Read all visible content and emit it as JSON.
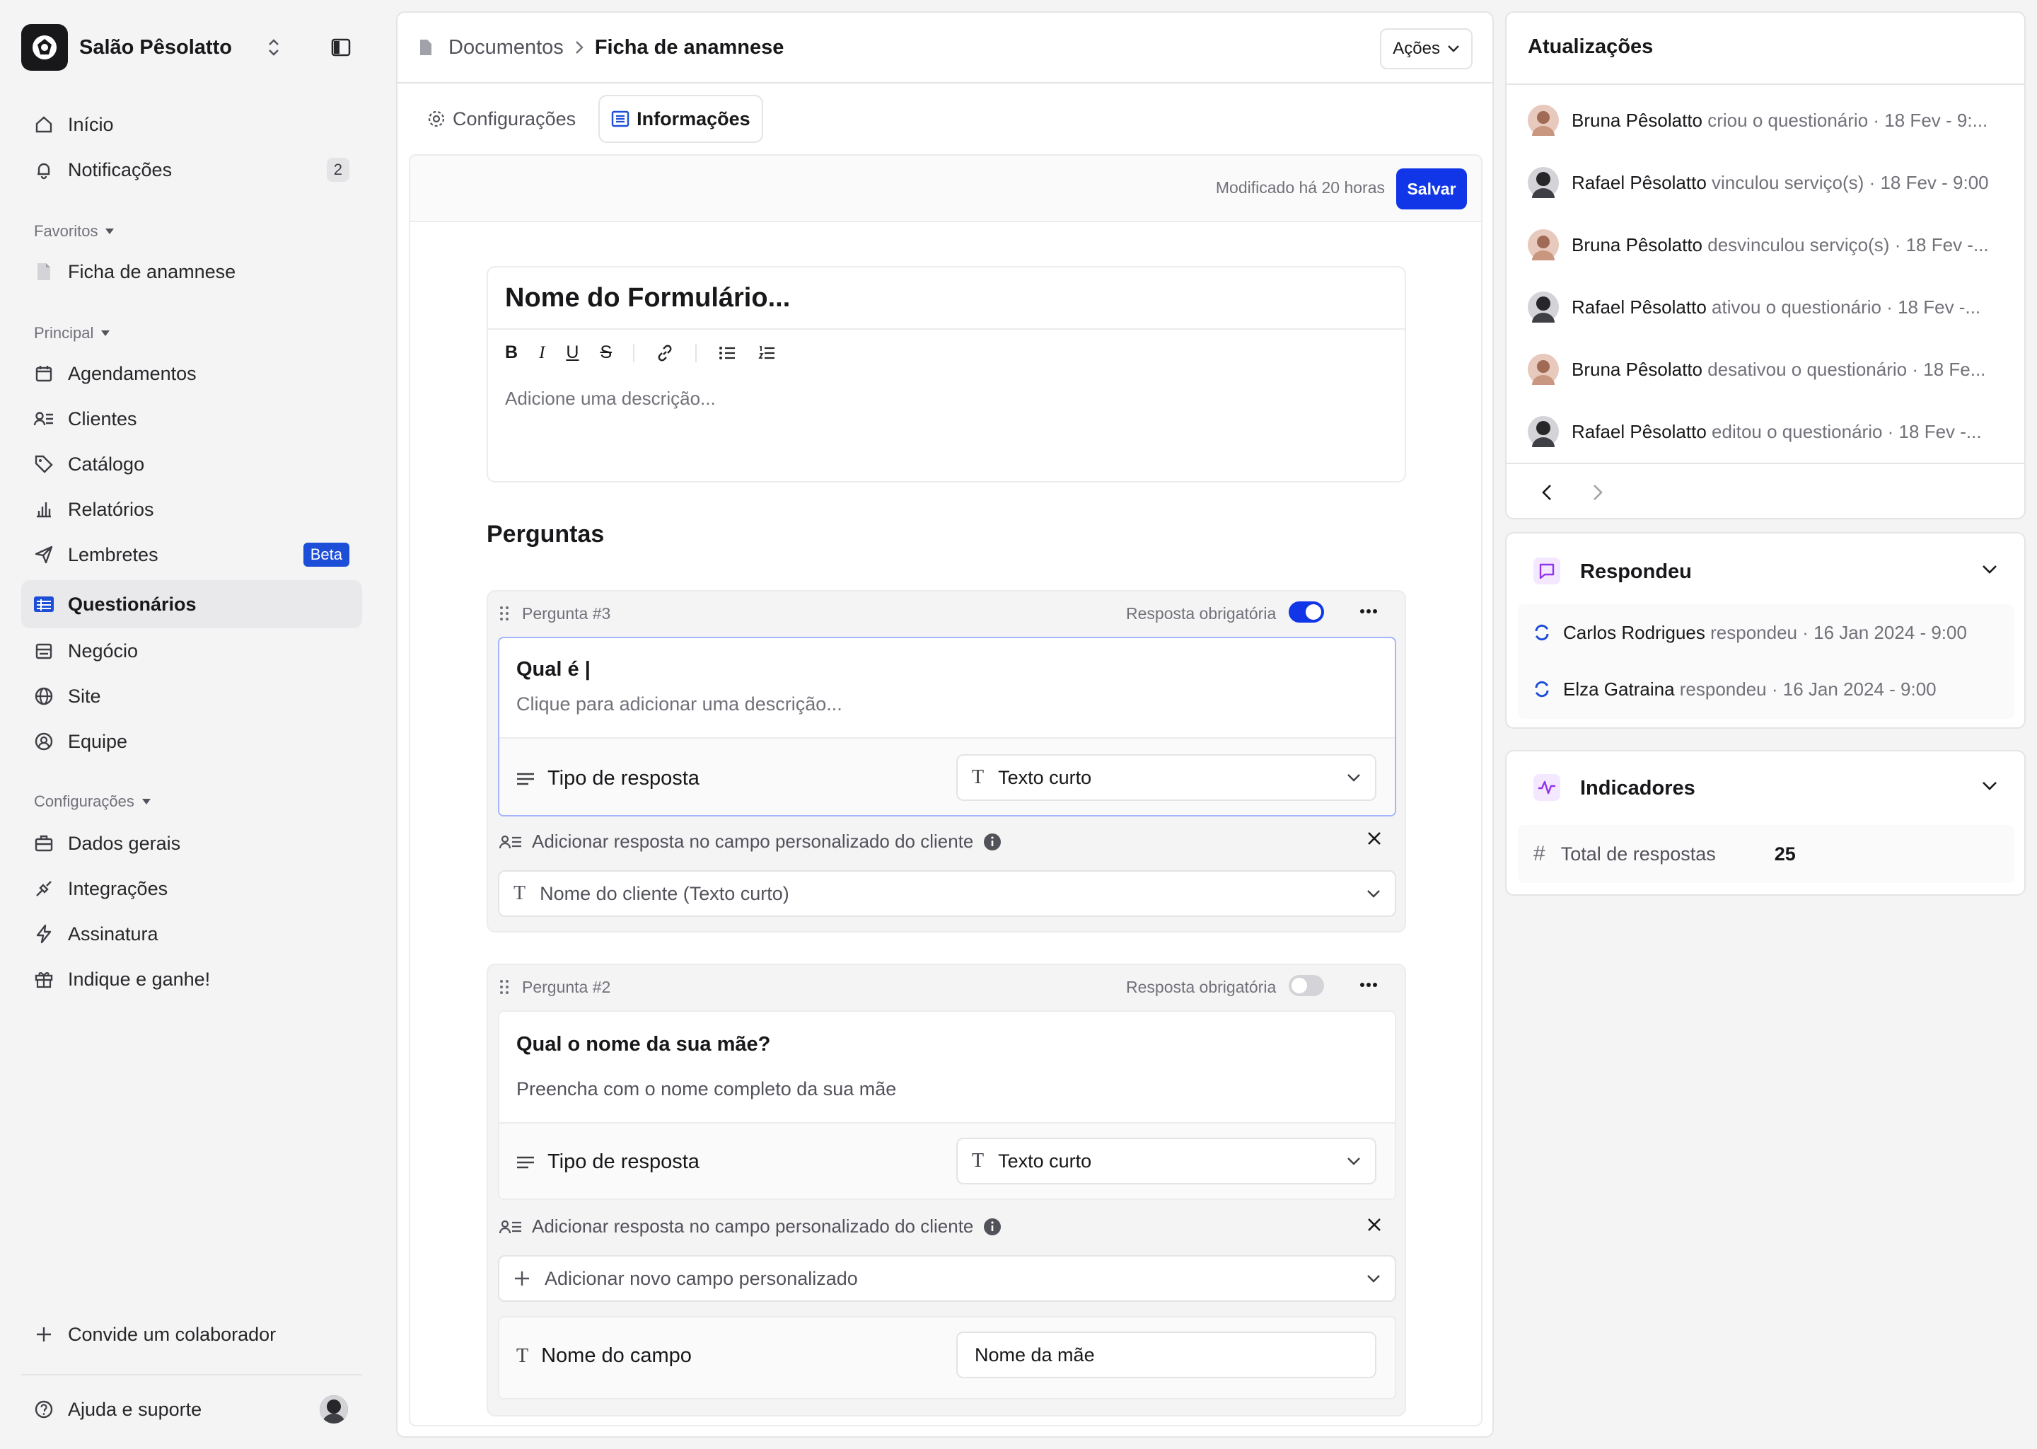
{
  "workspace": {
    "name": "Salão Pêsolatto"
  },
  "nav_top": [
    {
      "label": "Início",
      "icon": "home-icon"
    },
    {
      "label": "Notificações",
      "icon": "bell-icon",
      "count": "2"
    }
  ],
  "favorites": {
    "title": "Favoritos",
    "items": [
      {
        "label": "Ficha de anamnese",
        "icon": "document-icon"
      }
    ]
  },
  "principal": {
    "title": "Principal",
    "items": [
      {
        "label": "Agendamentos",
        "icon": "calendar-icon"
      },
      {
        "label": "Clientes",
        "icon": "clients-icon"
      },
      {
        "label": "Catálogo",
        "icon": "tag-icon"
      },
      {
        "label": "Relatórios",
        "icon": "chart-icon"
      },
      {
        "label": "Lembretes",
        "icon": "send-icon",
        "badge": "Beta"
      },
      {
        "label": "Questionários",
        "icon": "form-icon",
        "active": true
      },
      {
        "label": "Negócio",
        "icon": "store-icon"
      },
      {
        "label": "Site",
        "icon": "globe-icon"
      },
      {
        "label": "Equipe",
        "icon": "team-icon"
      }
    ]
  },
  "config": {
    "title": "Configurações",
    "items": [
      {
        "label": "Dados gerais",
        "icon": "briefcase-icon"
      },
      {
        "label": "Integrações",
        "icon": "plug-icon"
      },
      {
        "label": "Assinatura",
        "icon": "bolt-icon"
      },
      {
        "label": "Indique e ganhe!",
        "icon": "gift-icon"
      }
    ]
  },
  "sidebar_footer": {
    "invite": "Convide um colaborador",
    "help": "Ajuda e suporte"
  },
  "header": {
    "crumb_parent": "Documentos",
    "crumb_current": "Ficha de anamnese",
    "actions": "Ações"
  },
  "tabs": {
    "config": "Configurações",
    "info": "Informações"
  },
  "form": {
    "modified": "Modificado há 20 horas",
    "save": "Salvar",
    "title": "Nome do Formulário...",
    "description_placeholder": "Adicione uma descrição...",
    "questions_heading": "Perguntas"
  },
  "q3": {
    "label": "Pergunta #3",
    "required_label": "Resposta obrigatória",
    "required": true,
    "title": "Qual é |",
    "description_placeholder": "Clique para adicionar uma descrição...",
    "answer_type_label": "Tipo de resposta",
    "answer_type": "Texto curto",
    "custom_field_label": "Adicionar resposta no campo personalizado do cliente",
    "custom_field_value": "Nome do cliente (Texto curto)"
  },
  "q2": {
    "label": "Pergunta #2",
    "required_label": "Resposta obrigatória",
    "required": false,
    "title": "Qual o nome da sua mãe?",
    "description": "Preencha com o nome completo da sua mãe",
    "answer_type_label": "Tipo de resposta",
    "answer_type": "Texto curto",
    "custom_field_label": "Adicionar resposta no campo personalizado do cliente",
    "new_field": "Adicionar novo campo personalizado",
    "field_name_label": "Nome do campo",
    "field_name_value": "Nome da mãe"
  },
  "updates": {
    "title": "Atualizações",
    "items": [
      {
        "name": "Bruna Pêsolatto",
        "action": "criou o questionário",
        "time": "· 18 Fev - 9:..."
      },
      {
        "name": "Rafael Pêsolatto",
        "action": "vinculou serviço(s)",
        "time": "· 18 Fev - 9:00"
      },
      {
        "name": "Bruna Pêsolatto",
        "action": "desvinculou serviço(s)",
        "time": "· 18 Fev -..."
      },
      {
        "name": "Rafael Pêsolatto",
        "action": "ativou o questionário",
        "time": "· 18 Fev -..."
      },
      {
        "name": "Bruna Pêsolatto",
        "action": "desativou o questionário",
        "time": "· 18 Fe..."
      },
      {
        "name": "Rafael Pêsolatto",
        "action": "editou o questionário",
        "time": "· 18 Fev -..."
      }
    ]
  },
  "responded": {
    "title": "Respondeu",
    "items": [
      {
        "name": "Carlos Rodrigues",
        "action": "respondeu",
        "time": "· 16 Jan 2024 - 9:00"
      },
      {
        "name": "Elza Gatraina",
        "action": "respondeu",
        "time": "· 16 Jan 2024 - 9:00"
      }
    ]
  },
  "indicators": {
    "title": "Indicadores",
    "total_label": "Total de respostas",
    "total_value": "25"
  },
  "colors": {
    "accent": "#1036e8",
    "purple": "#9333ea"
  }
}
